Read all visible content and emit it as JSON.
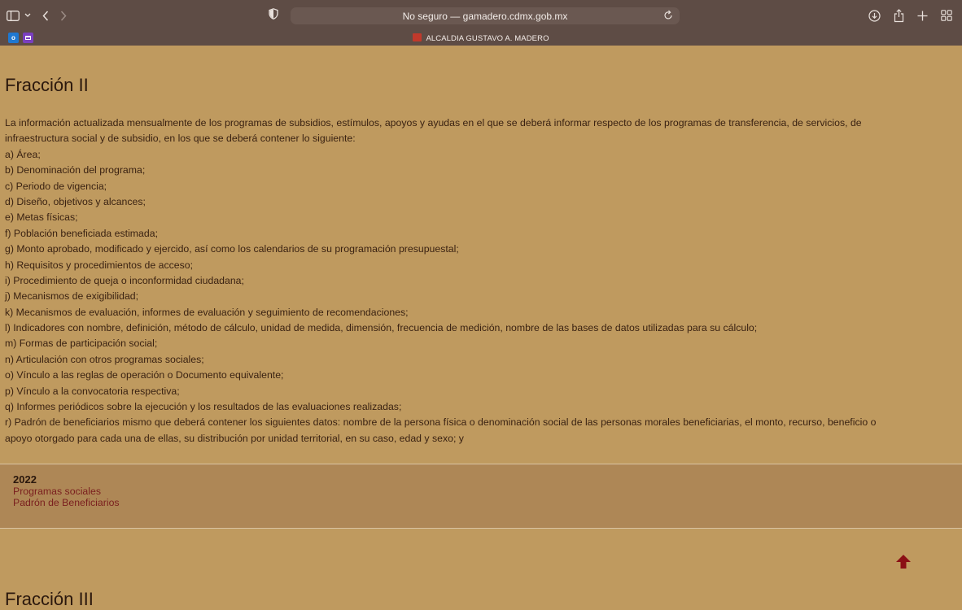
{
  "browser": {
    "url_text": "No seguro — gamadero.cdmx.gob.mx",
    "tab_title": "ALCALDIA GUSTAVO A. MADERO"
  },
  "page": {
    "heading": "Fracción II",
    "lines": [
      "La información actualizada mensualmente de los programas de subsidios, estímulos, apoyos y ayudas en el que se deberá informar respecto de los programas de transferencia, de servicios, de",
      "infraestructura social y de subsidio, en los que se deberá contener lo siguiente:",
      "a) Área;",
      "b) Denominación del programa;",
      "c) Periodo de vigencia;",
      "d) Diseño, objetivos y alcances;",
      "e) Metas físicas;",
      "f) Población beneficiada estimada;",
      "g) Monto aprobado, modificado y ejercido, así como los calendarios de su programación presupuestal;",
      "h) Requisitos y procedimientos de acceso;",
      "i) Procedimiento de queja o inconformidad ciudadana;",
      "j) Mecanismos de exigibilidad;",
      "k) Mecanismos de evaluación, informes de evaluación y seguimiento de recomendaciones;",
      "l) Indicadores con nombre, definición, método de cálculo, unidad de medida, dimensión, frecuencia de medición, nombre de las bases de datos utilizadas para su cálculo;",
      "m) Formas de participación social;",
      "n) Articulación con otros programas sociales;",
      "o) Vínculo a las reglas de operación o Documento equivalente;",
      "p) Vínculo a la convocatoria respectiva;",
      "q) Informes periódicos sobre la ejecución y los resultados de las evaluaciones realizadas;",
      "r) Padrón de beneficiarios mismo que deberá contener los siguientes datos: nombre de la persona física o denominación social de las personas morales beneficiarias, el monto, recurso, beneficio o",
      "apoyo otorgado para cada una de ellas, su distribución por unidad territorial, en su caso, edad y sexo; y"
    ],
    "section": {
      "year": "2022",
      "link1": "Programas sociales",
      "link2": "Padrón de Beneficiarios"
    },
    "next_heading": "Fracción III"
  },
  "colors": {
    "page_bg": "#bf9a5f",
    "section_bg": "#ae8756",
    "link": "#7a1e1e",
    "arrow": "#8b0f14"
  }
}
